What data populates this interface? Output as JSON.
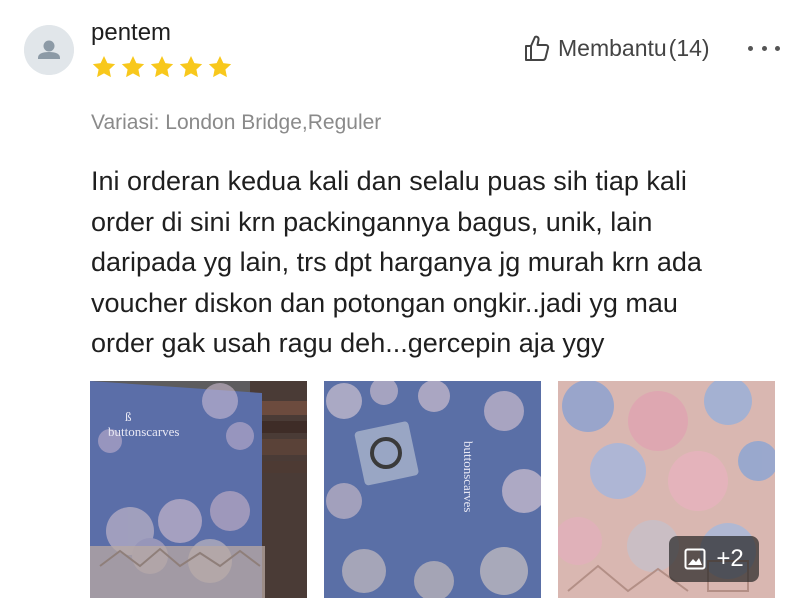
{
  "review": {
    "username": "pentem",
    "rating": 5,
    "rating_max": 5,
    "helpful_label": "Membantu",
    "helpful_count": "(14)",
    "variation": "Variasi: London Bridge,Reguler",
    "text": "Ini orderan kedua kali dan selalu puas sih tiap kali\norder di sini krn packingannya bagus, unik, lain\ndaripada yg lain, trs dpt harganya jg murah krn ada\nvoucher diskon dan potongan ongkir..jadi yg mau\norder gak usah ragu deh...gercepin aja ygy",
    "photos": [
      {
        "brand_text": "buttonscarves"
      },
      {
        "brand_text": "buttonscarves"
      },
      {
        "brand_text": ""
      }
    ],
    "more_photos_label": "+2"
  },
  "colors": {
    "star": "#f8c81c",
    "avatar_bg": "#e1e6ea",
    "avatar_fg": "#8c9aa6",
    "variation_text": "#8a8a8a",
    "scarf_blue": "#5a6fa6"
  },
  "icons": {
    "avatar": "person-icon",
    "star": "star-icon",
    "helpful": "thumbs-up-icon",
    "more": "more-dots-icon",
    "gallery": "image-icon"
  }
}
